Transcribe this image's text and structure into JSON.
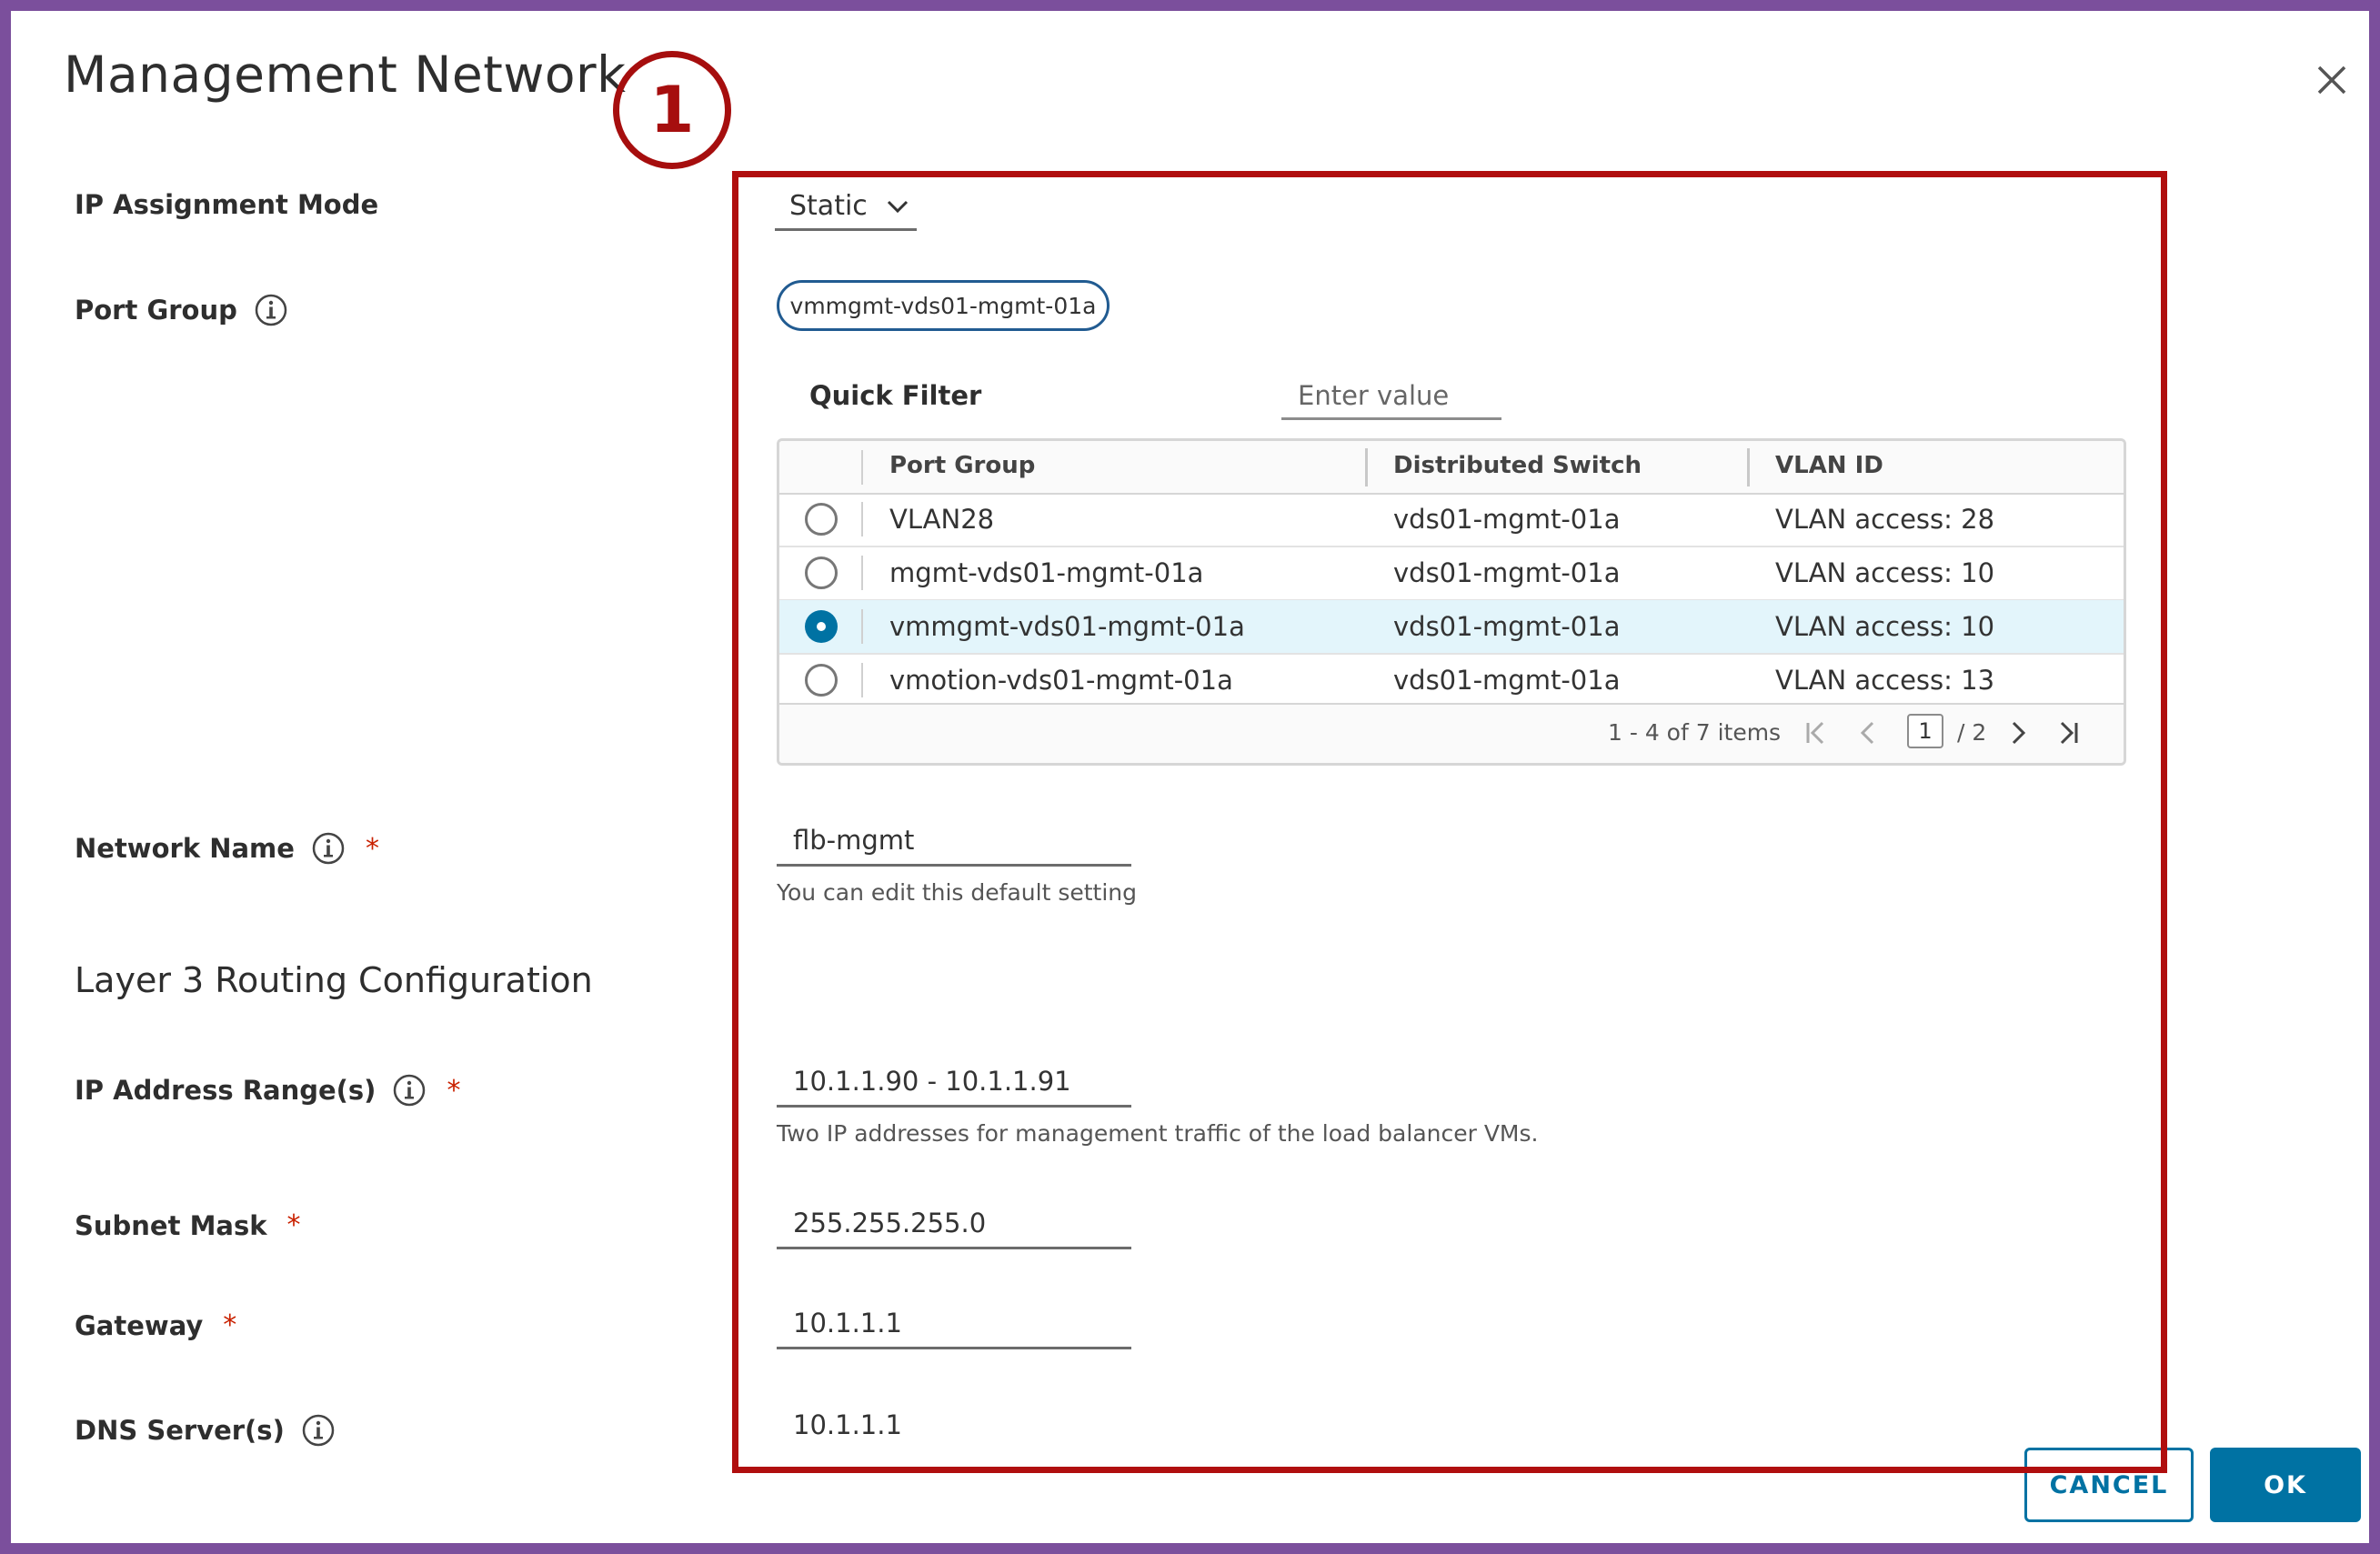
{
  "dialog": {
    "title": "Management Network",
    "step_badge": "1",
    "close_icon": "close-icon"
  },
  "fields": {
    "ip_mode_label": "IP Assignment Mode",
    "ip_mode_value": "Static",
    "port_group_label": "Port Group",
    "port_group_selected": "vmmgmt-vds01-mgmt-01a",
    "network_name_label": "Network Name",
    "network_name_value": "flb-mgmt",
    "network_name_help": "You can edit this default setting",
    "layer3_heading": "Layer 3 Routing Configuration",
    "ip_range_label": "IP Address Range(s)",
    "ip_range_value": "10.1.1.90 - 10.1.1.91",
    "ip_range_help": "Two IP addresses for management traffic of the load balancer VMs.",
    "subnet_label": "Subnet Mask",
    "subnet_value": "255.255.255.0",
    "gateway_label": "Gateway",
    "gateway_value": "10.1.1.1",
    "dns_label": "DNS Server(s)",
    "dns_value": "10.1.1.1",
    "required_mark": "*"
  },
  "filter": {
    "label": "Quick Filter",
    "placeholder": "Enter value"
  },
  "table": {
    "columns": [
      "Port Group",
      "Distributed Switch",
      "VLAN ID"
    ],
    "rows": [
      {
        "port_group": "VLAN28",
        "switch": "vds01-mgmt-01a",
        "vlan": "VLAN access: 28",
        "selected": false
      },
      {
        "port_group": "mgmt-vds01-mgmt-01a",
        "switch": "vds01-mgmt-01a",
        "vlan": "VLAN access: 10",
        "selected": false
      },
      {
        "port_group": "vmmgmt-vds01-mgmt-01a",
        "switch": "vds01-mgmt-01a",
        "vlan": "VLAN access: 10",
        "selected": true
      },
      {
        "port_group": "vmotion-vds01-mgmt-01a",
        "switch": "vds01-mgmt-01a",
        "vlan": "VLAN access: 13",
        "selected": false
      }
    ],
    "pagination": {
      "count_text": "1 - 4 of 7 items",
      "current_page": "1",
      "total_text": "/ 2"
    }
  },
  "buttons": {
    "cancel": "CANCEL",
    "ok": "OK"
  },
  "colors": {
    "frame": "#7b4f9c",
    "annotation": "#b00e0e",
    "primary": "#0072a3",
    "selected_row": "#e3f5fb"
  }
}
